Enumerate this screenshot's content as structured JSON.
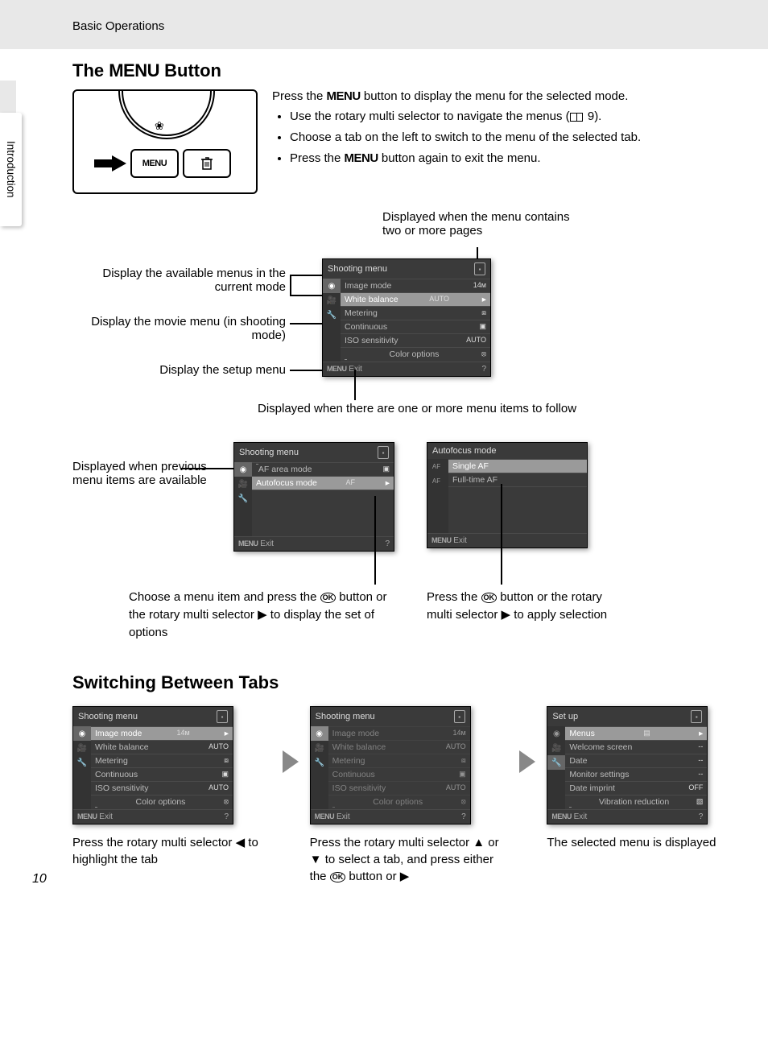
{
  "header": {
    "breadcrumb": "Basic Operations"
  },
  "sidebar": {
    "tab": "Introduction"
  },
  "section1": {
    "title_pre": "The ",
    "title_menu": "MENU",
    "title_post": " Button",
    "diagram": {
      "menu_label": "MENU"
    },
    "intro_pre": "Press the ",
    "intro_menu": "MENU",
    "intro_post": " button to display the menu for the selected mode.",
    "bullets": [
      {
        "pre": "Use the rotary multi selector to navigate the menus (",
        "ref": "9",
        "post": ")."
      },
      {
        "text": "Choose a tab on the left to switch to the menu of the selected tab."
      },
      {
        "pre": "Press the ",
        "menu": "MENU",
        "post": " button again to exit the menu."
      }
    ]
  },
  "callouts": {
    "multipage": "Displayed when the menu contains two or more pages",
    "available_menus": "Display the available menus in the current mode",
    "movie_menu": "Display the movie menu (in shooting mode)",
    "setup_menu": "Display the setup menu",
    "more_follow": "Displayed when there are one or more menu items to follow",
    "prev_available": "Displayed when previous menu items are available",
    "choose_item": {
      "pre": "Choose a menu item and press the ",
      "mid": " button or the rotary multi selector ",
      "arrow": "▶",
      "post": " to display the set of options"
    },
    "apply": {
      "pre": "Press the ",
      "mid": " button or the rotary multi selector ",
      "arrow": "▶",
      "post": " to apply selection"
    }
  },
  "lcd_main": {
    "title": "Shooting menu",
    "items": [
      {
        "label": "Image mode",
        "val": "14ᴍ"
      },
      {
        "label": "White balance",
        "val": "AUTO",
        "sel": true
      },
      {
        "label": "Metering",
        "val": "⧈"
      },
      {
        "label": "Continuous",
        "val": "▣"
      },
      {
        "label": "ISO sensitivity",
        "val": "AUTO"
      },
      {
        "label": "Color options",
        "val": "⦻"
      }
    ],
    "exit": "Exit"
  },
  "lcd_page2": {
    "title": "Shooting menu",
    "items": [
      {
        "label": "AF area mode",
        "val": "▣"
      },
      {
        "label": "Autofocus mode",
        "val": "AF",
        "sel": true
      }
    ],
    "exit": "Exit"
  },
  "lcd_af": {
    "title": "Autofocus mode",
    "items": [
      {
        "label": "Single AF",
        "sel": true
      },
      {
        "label": "Full-time AF"
      }
    ],
    "exit": "Exit"
  },
  "section2": {
    "title": "Switching Between Tabs",
    "step1": {
      "pre": "Press the rotary multi selector ",
      "arrow": "◀",
      "post": " to highlight the tab"
    },
    "step2": {
      "pre": "Press the rotary multi selector ",
      "a1": "▲",
      "mid1": " or ",
      "a2": "▼",
      "mid2": " to select a tab, and press either the ",
      "mid3": " button or ",
      "a3": "▶"
    },
    "step3": "The selected menu is displayed"
  },
  "lcd_step1": {
    "title": "Shooting menu",
    "items": [
      {
        "label": "Image mode",
        "val": "14ᴍ",
        "sel": true
      },
      {
        "label": "White balance",
        "val": "AUTO"
      },
      {
        "label": "Metering",
        "val": "⧈"
      },
      {
        "label": "Continuous",
        "val": "▣"
      },
      {
        "label": "ISO sensitivity",
        "val": "AUTO"
      },
      {
        "label": "Color options",
        "val": "⦻"
      }
    ],
    "exit": "Exit"
  },
  "lcd_step2": {
    "title": "Shooting menu",
    "items": [
      {
        "label": "Image mode",
        "val": "14ᴍ",
        "dim": true
      },
      {
        "label": "White balance",
        "val": "AUTO",
        "dim": true
      },
      {
        "label": "Metering",
        "val": "⧈",
        "dim": true
      },
      {
        "label": "Continuous",
        "val": "▣",
        "dim": true
      },
      {
        "label": "ISO sensitivity",
        "val": "AUTO",
        "dim": true
      },
      {
        "label": "Color options",
        "val": "⦻",
        "dim": true
      }
    ],
    "exit": "Exit"
  },
  "lcd_step3": {
    "title": "Set up",
    "items": [
      {
        "label": "Menus",
        "val": "▤",
        "sel": true
      },
      {
        "label": "Welcome screen",
        "val": "--"
      },
      {
        "label": "Date",
        "val": "--"
      },
      {
        "label": "Monitor settings",
        "val": "--"
      },
      {
        "label": "Date imprint",
        "val": "OFF"
      },
      {
        "label": "Vibration reduction",
        "val": "▧"
      }
    ],
    "exit": "Exit"
  },
  "page_number": "10"
}
